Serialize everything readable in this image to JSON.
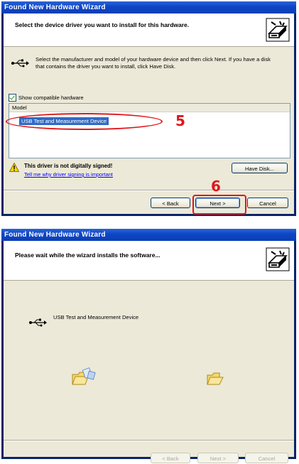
{
  "window1": {
    "title": "Found New Hardware Wizard",
    "header_title": "Select the device driver you want to install for this hardware.",
    "description": "Select the manufacturer and model of your hardware device and then click Next. If you have a disk that contains the driver you want to install, click Have Disk.",
    "show_compatible_label": "Show compatible hardware",
    "show_compatible_checked": true,
    "list_header": "Model",
    "list_items": [
      "USB Test and Measurement Device"
    ],
    "selected_item": "USB Test and Measurement Device",
    "warning_title": "This driver is not digitally signed!",
    "warning_link": "Tell me why driver signing is important",
    "have_disk_label": "Have Disk...",
    "back_label": "< Back",
    "next_label": "Next >",
    "cancel_label": "Cancel",
    "annotation_step_select": "5",
    "annotation_step_next": "6",
    "annotation_color": "#e0161a"
  },
  "window2": {
    "title": "Found New Hardware Wizard",
    "header_title": "Please wait while the wizard installs the software...",
    "device_name": "USB Test and Measurement Device",
    "back_label": "< Back",
    "next_label": "Next >",
    "cancel_label": "Cancel"
  },
  "icons": [
    "wizard-hardware-icon",
    "usb-icon",
    "warning-icon",
    "folder-flying-icon",
    "folder-icon"
  ],
  "colors": {
    "titlebar": "#0d45c4",
    "dialog_bg": "#ece9d8",
    "selection": "#316ac5",
    "link": "#0000ff"
  }
}
